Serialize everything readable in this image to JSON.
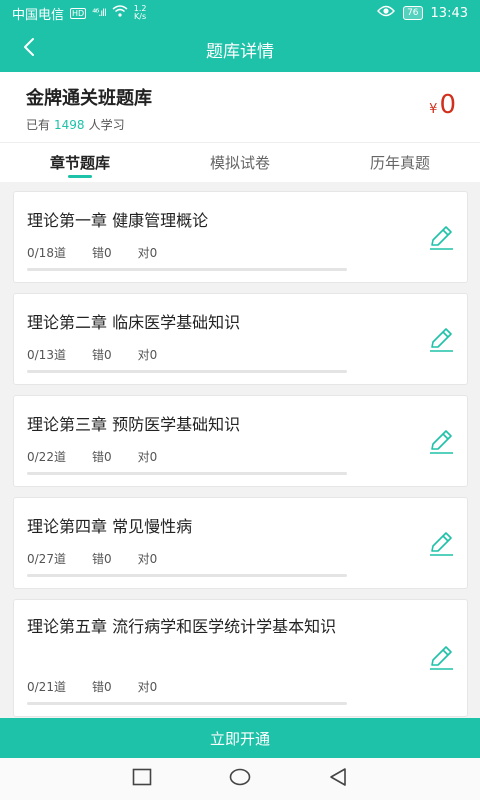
{
  "status_bar": {
    "carrier": "中国电信",
    "hd": "HD",
    "signal": "⁴⁶.ıll",
    "speed_value": "1.2",
    "speed_unit": "K/s",
    "battery": "76",
    "time": "13:43"
  },
  "header": {
    "title": "题库详情"
  },
  "course": {
    "title": "金牌通关班题库",
    "learners_prefix": "已有",
    "learners_count": "1498",
    "learners_suffix": "人学习",
    "currency": "¥",
    "price": "0"
  },
  "tabs": [
    {
      "label": "章节题库",
      "active": true
    },
    {
      "label": "模拟试卷",
      "active": false
    },
    {
      "label": "历年真题",
      "active": false
    }
  ],
  "chapters": [
    {
      "title": "理论第一章 健康管理概论",
      "progress": "0/18道",
      "wrong": "错0",
      "right": "对0",
      "done_fraction": 0
    },
    {
      "title": "理论第二章 临床医学基础知识",
      "progress": "0/13道",
      "wrong": "错0",
      "right": "对0",
      "done_fraction": 0
    },
    {
      "title": "理论第三章 预防医学基础知识",
      "progress": "0/22道",
      "wrong": "错0",
      "right": "对0",
      "done_fraction": 0
    },
    {
      "title": "理论第四章 常见慢性病",
      "progress": "0/27道",
      "wrong": "错0",
      "right": "对0",
      "done_fraction": 0
    },
    {
      "title": "理论第五章 流行病学和医学统计学基本知识",
      "progress": "0/21道",
      "wrong": "错0",
      "right": "对0",
      "done_fraction": 0
    }
  ],
  "action": {
    "label": "立即开通"
  },
  "colors": {
    "accent": "#1ec2a8",
    "price": "#d0301c"
  },
  "icons": [
    "back-arrow-icon",
    "edit-pencil-icon",
    "eye-icon",
    "wifi-icon",
    "nav-square-icon",
    "nav-circle-icon",
    "nav-triangle-icon"
  ]
}
